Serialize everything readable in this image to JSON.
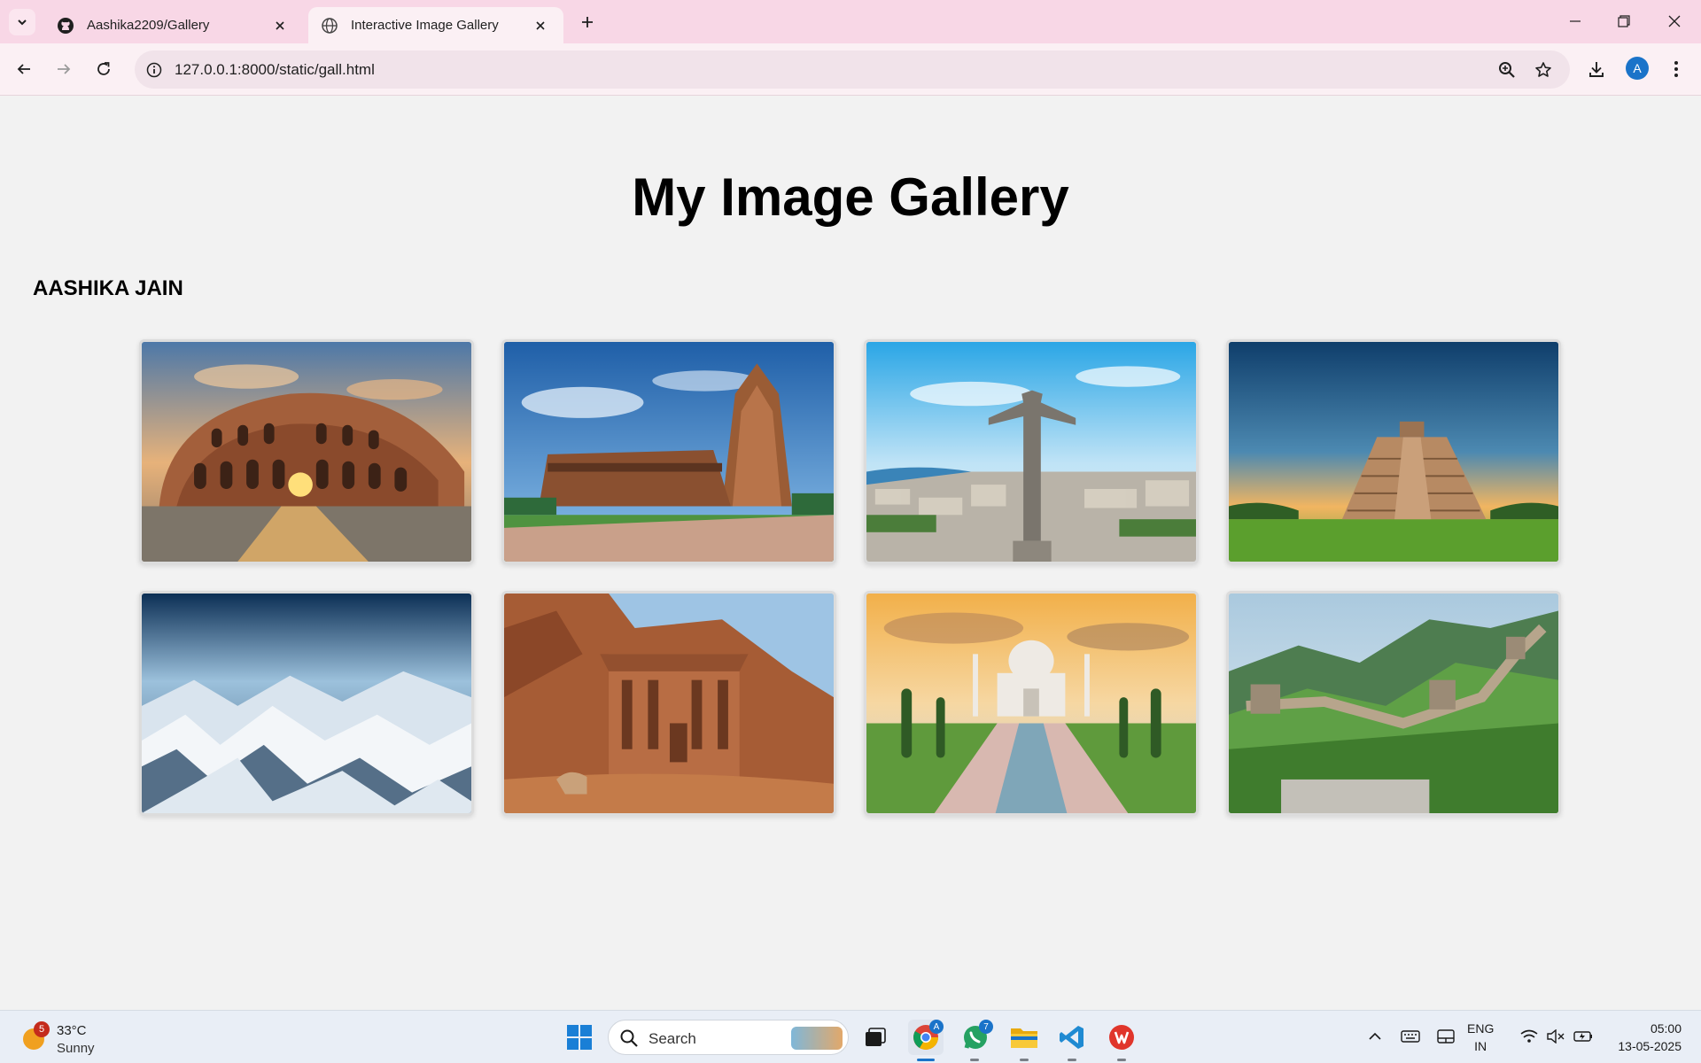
{
  "browser": {
    "tabs": [
      {
        "title": "Aashika2209/Gallery",
        "icon": "github-icon",
        "active": false
      },
      {
        "title": "Interactive Image Gallery",
        "icon": "globe-icon",
        "active": true
      }
    ],
    "url": "127.0.0.1:8000/static/gall.html",
    "profile_initial": "A"
  },
  "page": {
    "title": "My Image Gallery",
    "author": "AASHIKA JAIN",
    "gallery": [
      {
        "subject": "colosseum-photo"
      },
      {
        "subject": "brihadeeswarar-temple-photo"
      },
      {
        "subject": "christ-statue-photo"
      },
      {
        "subject": "chichen-itza-pyramid-photo"
      },
      {
        "subject": "snowy-mountains-photo"
      },
      {
        "subject": "petra-monastery-photo"
      },
      {
        "subject": "taj-mahal-photo"
      },
      {
        "subject": "great-wall-photo"
      }
    ]
  },
  "taskbar": {
    "weather": {
      "temp": "33°C",
      "condition": "Sunny",
      "badge": "5"
    },
    "search_placeholder": "Search",
    "whatsapp_badge": "7",
    "lang_line1": "ENG",
    "lang_line2": "IN",
    "time": "05:00",
    "date": "13-05-2025"
  },
  "colors": {
    "tabbar": "#f8d7e6",
    "toolbar": "#fbf0f4",
    "page_bg": "#f2f2f2",
    "taskbar": "#e9eef6",
    "accent": "#1a73c9"
  }
}
